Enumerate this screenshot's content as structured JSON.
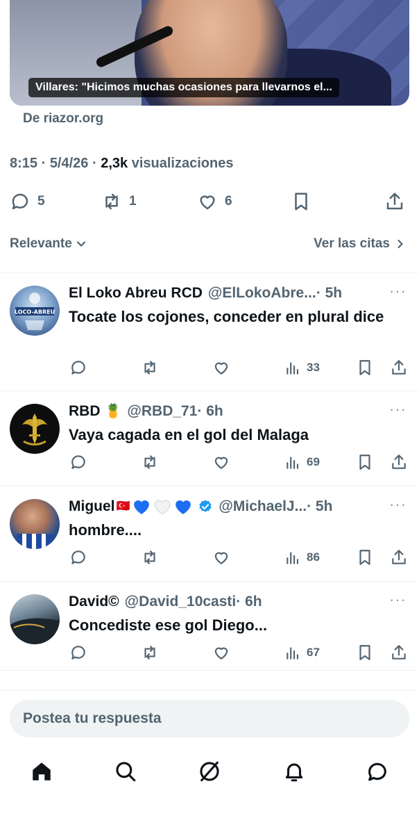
{
  "link_card": {
    "caption": "Villares: \"Hicimos muchas ocasiones para llevarnos el...",
    "source": "De riazor.org"
  },
  "post_meta": {
    "time": "8:15",
    "sep1": " · ",
    "date": "5/4/26",
    "sep2": " · ",
    "views_count": "2,3k",
    "views_label": " visualizaciones"
  },
  "post_actions": {
    "replies": "5",
    "reposts": "1",
    "likes": "6"
  },
  "sort": {
    "label": "Relevante",
    "quotes_link": "Ver las citas"
  },
  "replies": [
    {
      "name": "El Loko Abreu RCD",
      "handle": "@ElLokoAbre...",
      "time": " · 5h",
      "text": "Tocate los cojones, conceder en plural dice",
      "views": "33",
      "avatar_text": "LOCO-ABREU"
    },
    {
      "name": "RBD",
      "name_emoji": "🍍",
      "handle": "@RBD_71",
      "time": " · 6h",
      "text": "Vaya cagada en el gol del Malaga",
      "views": "69"
    },
    {
      "name": "Miguel",
      "name_flag": "🇹🇷",
      "handle": "@MichaelJ...",
      "time": " · 5h",
      "text": "hombre....",
      "views": "86",
      "heart_colors": [
        "#1d6ef2",
        "#f2f2f2",
        "#1d6ef2"
      ]
    },
    {
      "name": "David©",
      "handle": "@David_10casti",
      "time": " · 6h",
      "text": "Concediste ese gol Diego...",
      "views": "67"
    }
  ],
  "composer": {
    "placeholder": "Postea tu respuesta"
  },
  "tabbar": [
    "home-icon",
    "search-icon",
    "grok-icon",
    "bell-icon",
    "messages-icon"
  ],
  "colors": {
    "text": "#0f1419",
    "secondary": "#536471",
    "divider": "#eff3f4",
    "verified": "#1d9bf0"
  }
}
